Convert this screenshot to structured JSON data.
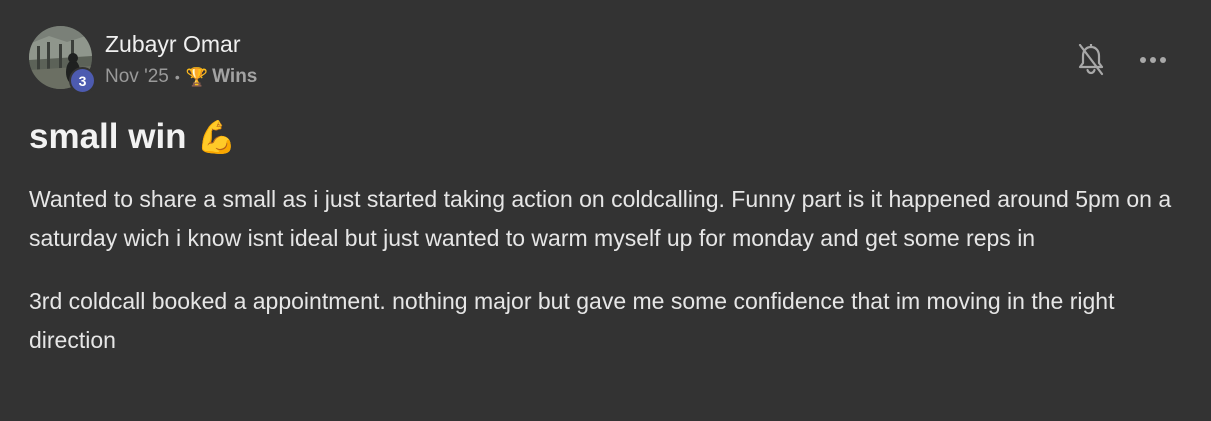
{
  "author": {
    "name": "Zubayr Omar",
    "level": "3"
  },
  "post_info": {
    "date": "Nov '25",
    "separator": "•",
    "category_icon": "trophy-icon",
    "category": "Wins"
  },
  "actions": {
    "bell_icon": "bell-muted-icon",
    "more_icon": "more-horizontal-icon"
  },
  "title": {
    "text": "small win",
    "emoji": "💪"
  },
  "body": {
    "paragraphs": [
      "Wanted to share a small as i just started taking action on coldcalling. Funny part is it happened around 5pm on a saturday wich i know isnt ideal but just wanted to warm myself up for monday and get some reps in",
      "3rd coldcall booked a appointment. nothing major but gave me some confidence that im moving in the right direction"
    ]
  },
  "colors": {
    "background": "#333333",
    "level_badge": "#4d5bb0",
    "text_primary": "#e6e6e6",
    "text_muted": "#9a9a9a"
  }
}
